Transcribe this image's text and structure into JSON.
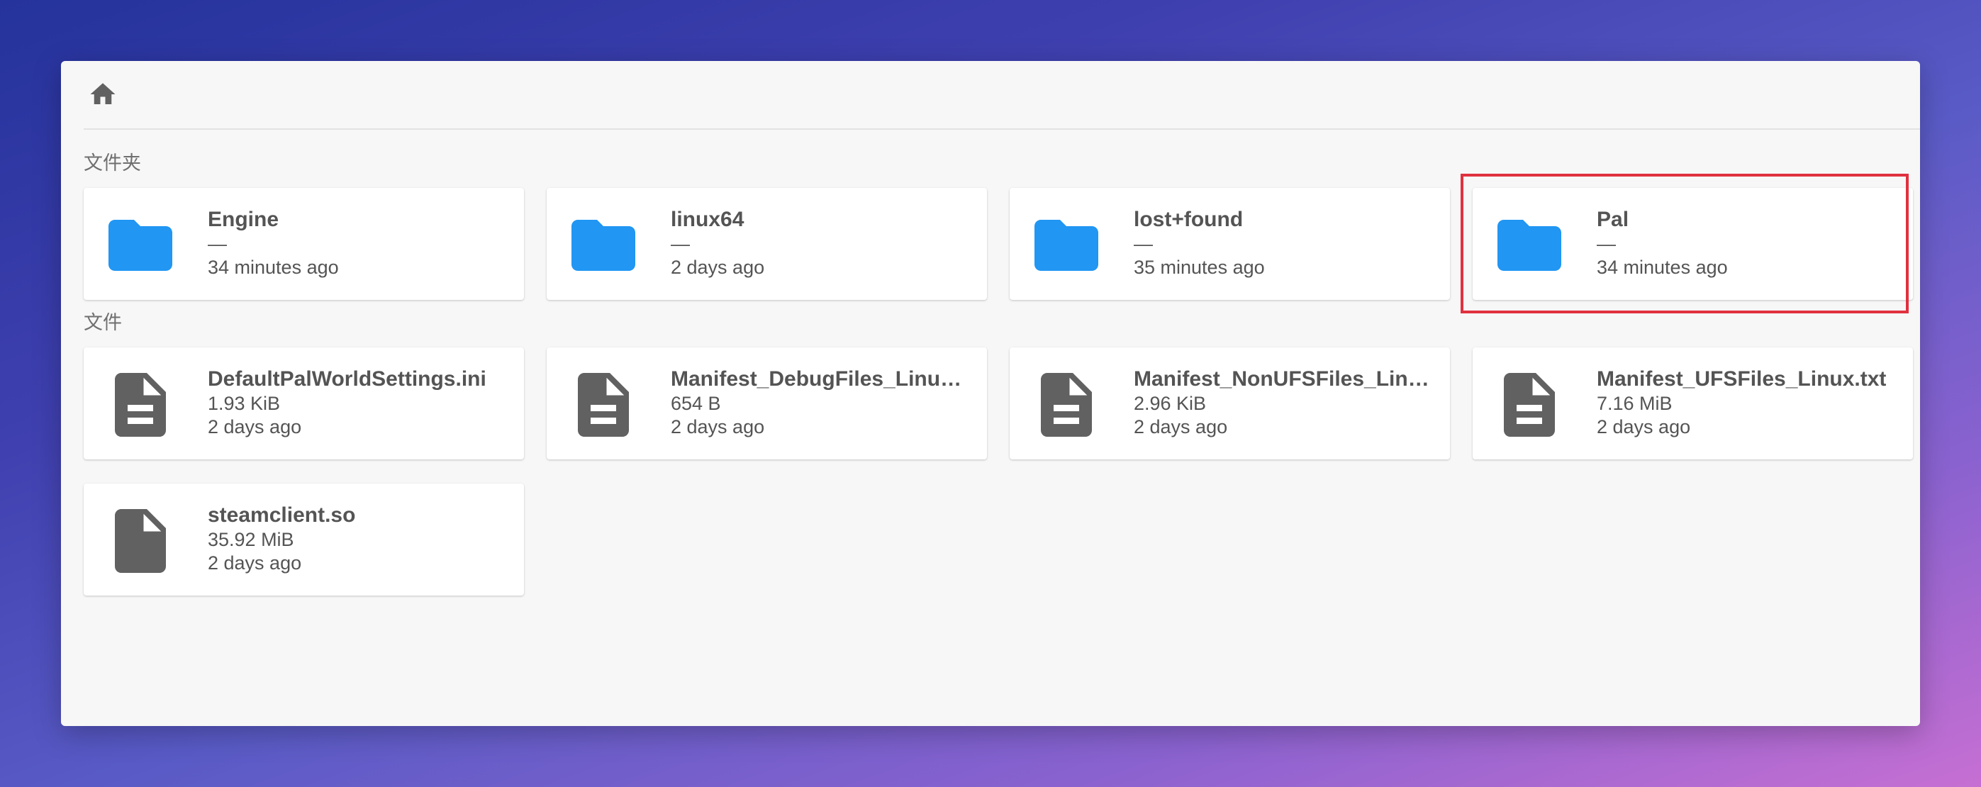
{
  "toolbar": {
    "home_icon": "home-icon"
  },
  "sections": {
    "folders_label": "文件夹",
    "files_label": "文件"
  },
  "folders": [
    {
      "name": "Engine",
      "size": "—",
      "modified": "34 minutes ago",
      "icon": "folder-icon"
    },
    {
      "name": "linux64",
      "size": "—",
      "modified": "2 days ago",
      "icon": "folder-icon"
    },
    {
      "name": "lost+found",
      "size": "—",
      "modified": "35 minutes ago",
      "icon": "folder-icon"
    },
    {
      "name": "Pal",
      "size": "—",
      "modified": "34 minutes ago",
      "icon": "folder-icon"
    }
  ],
  "files": [
    {
      "name": "DefaultPalWorldSettings.ini",
      "size": "1.93 KiB",
      "modified": "2 days ago",
      "icon": "file-icon"
    },
    {
      "name": "Manifest_DebugFiles_Linux.txt",
      "size": "654 B",
      "modified": "2 days ago",
      "icon": "file-icon"
    },
    {
      "name": "Manifest_NonUFSFiles_Linux.txt",
      "size": "2.96 KiB",
      "modified": "2 days ago",
      "icon": "file-icon"
    },
    {
      "name": "Manifest_UFSFiles_Linux.txt",
      "size": "7.16 MiB",
      "modified": "2 days ago",
      "icon": "file-icon"
    },
    {
      "name": "steamclient.so",
      "size": "35.92 MiB",
      "modified": "2 days ago",
      "icon": "file-icon"
    }
  ],
  "colors": {
    "folder": "#2196f3",
    "file": "#616161",
    "highlight": "#e0313f"
  }
}
